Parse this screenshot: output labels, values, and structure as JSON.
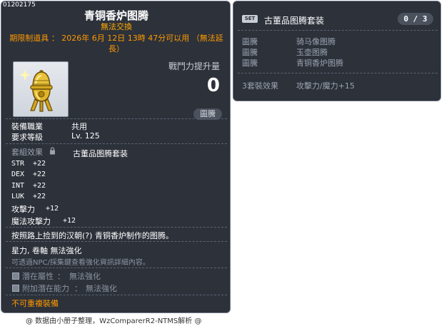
{
  "item": {
    "id": "01202175",
    "name": "青铜香炉图腾",
    "trade": "無法交換",
    "period": "期限制道具 ： 2026年 6月 12日 13時 47分可以用 （無法延長）",
    "power_label": "戰鬥力提升量",
    "power_value": "0",
    "totem_label": "圖騰",
    "job_label": "裝備職業",
    "job_value": "共用",
    "level_label": "要求等級",
    "level_value": "Lv. 125",
    "set_effect_label": "套組效果",
    "set_name": "古董品图腾套装",
    "stats": [
      {
        "name": "STR",
        "value": "+22"
      },
      {
        "name": "DEX",
        "value": "+22"
      },
      {
        "name": "INT",
        "value": "+22"
      },
      {
        "name": "LUK",
        "value": "+22"
      },
      {
        "name": "攻擊力",
        "value": "+12"
      },
      {
        "name": "魔法攻擊力",
        "value": "+12"
      }
    ],
    "description": "按照路上捡到的汉朝(?) 青铜香炉制作的图腾。",
    "enhance": "星力, 卷軸 無法強化",
    "npc_hint": "可透過NPC/採集鍵查看強化資訊詳細內容。",
    "potential": {
      "label": "潛在屬性",
      "value": "無法強化"
    },
    "bonus_potential": {
      "label": "附加潛在能力",
      "value": "無法強化"
    },
    "no_duplicate": "不可重複裝備"
  },
  "set_panel": {
    "badge": "SET",
    "title": "古董品图腾套装",
    "count": "0 / 3",
    "pieces": [
      {
        "label": "圖騰",
        "name": "骑马像图腾"
      },
      {
        "label": "圖騰",
        "name": "玉壶图腾"
      },
      {
        "label": "圖騰",
        "name": "青铜香炉图腾"
      }
    ],
    "effect_label": "3套裝效果",
    "effect_value": "攻擊力/魔力+15"
  },
  "footer": "@ 数据由小册子整理，WzComparerR2-NTMS解析 @",
  "colors": {
    "panel_bg": "#252a34",
    "accent_orange": "#ff9900",
    "trade_yellow": "#ffaa00",
    "muted_gray": "#9ba3af"
  }
}
